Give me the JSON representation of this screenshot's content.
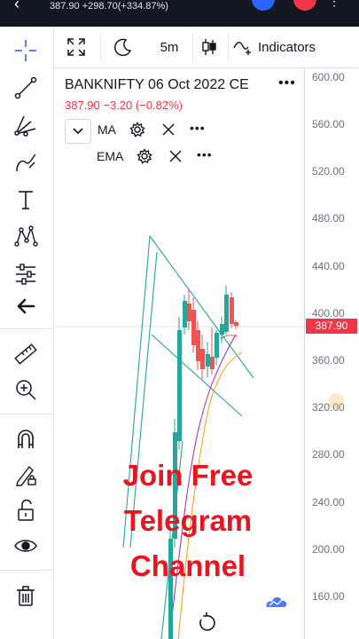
{
  "status_bar": {
    "quote": "387.90 +298.70(+334.87%)"
  },
  "top_toolbar": {
    "interval": "5m",
    "indicators_label": "Indicators"
  },
  "legend": {
    "symbol_title": "BANKNIFTY 06 Oct 2022 CE",
    "price_line": "387.90  −3.20 (−0.82%)",
    "indicators": [
      {
        "name": "MA"
      },
      {
        "name": "EMA"
      }
    ]
  },
  "price_axis": {
    "ticks": [
      "600.00",
      "560.00",
      "520.00",
      "480.00",
      "440.00",
      "400.00",
      "360.00",
      "320.00",
      "280.00",
      "240.00",
      "200.00",
      "160.00"
    ],
    "current_price": "387.90",
    "current_price_color": "#f23645"
  },
  "overlay": {
    "promo_lines": [
      "Join Free",
      "Telegram",
      "Channel"
    ],
    "promo_color": "#e8141f"
  },
  "colors": {
    "up": "#26a69a",
    "down": "#ef5350",
    "trendline": "#26a69a",
    "ma_line": "#9c27b0",
    "ema_line": "#ff9800"
  },
  "icons": {
    "left_toolbar": [
      "crosshair-icon",
      "trend-line-icon",
      "fib-icon",
      "brush-icon",
      "text-icon",
      "pattern-icon",
      "measure-tools-icon",
      "back-arrow-icon",
      "ruler-icon",
      "zoom-in-icon",
      "magnet-icon",
      "lock-drawing-icon",
      "unlock-icon",
      "eye-icon",
      "trash-icon"
    ]
  }
}
